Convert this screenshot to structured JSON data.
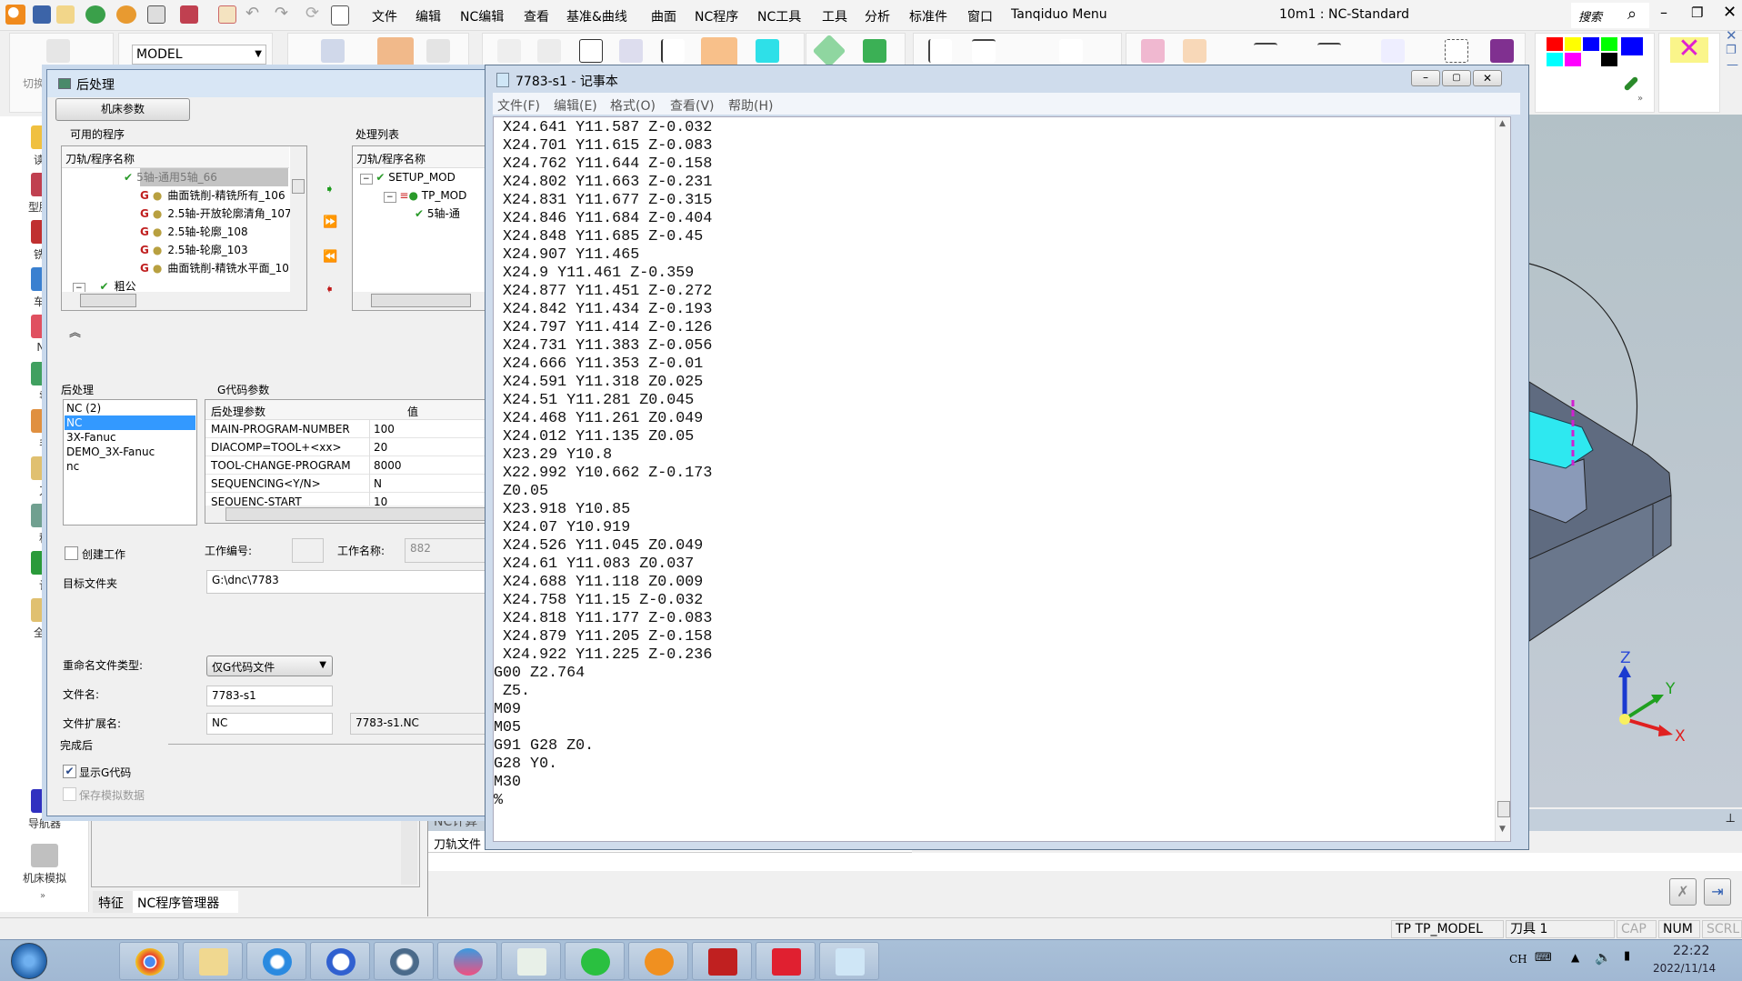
{
  "app": {
    "title": "10m1 : NC-Standard",
    "menu": [
      "文件",
      "编辑",
      "NC编辑",
      "查看",
      "基准&曲线",
      "曲面",
      "NC程序",
      "NC工具",
      "工具",
      "分析",
      "标准件",
      "窗口",
      "Tanqiduo Menu"
    ],
    "search_label": "搜索",
    "toolbar": {
      "model_combo": "MODEL",
      "switch_label": "切换"
    },
    "palette": [
      "#ff0000",
      "#ffff00",
      "#0000ff",
      "#00ff00",
      "#00ffff",
      "#ff00ff",
      "#ffffff",
      "#000000"
    ]
  },
  "sidebar": {
    "items": [
      "读取",
      "型腔管",
      "铣削",
      "车削",
      "NC",
      "零",
      "毛",
      "刀",
      "程",
      "计",
      "全局",
      "导航器",
      "机床模拟"
    ]
  },
  "dialog": {
    "title": "后处理",
    "machine_params_button": "机床参数",
    "available_label": "可用的程序",
    "available_header": "刀轨/程序名称",
    "available_rows": [
      "5轴-通用5轴_66",
      "曲面铣削-精铣所有_106",
      "2.5轴-开放轮廓清角_107",
      "2.5轴-轮廓_108",
      "2.5轴-轮廓_103",
      "曲面铣削-精铣水平面_10",
      "粗公"
    ],
    "process_label": "处理列表",
    "process_header": "刀轨/程序名称",
    "process_rows": [
      "SETUP_MOD",
      "TP_MOD",
      "5轴-通"
    ],
    "post_label": "后处理",
    "post_list": [
      "NC (2)",
      "NC",
      "3X-Fanuc",
      "DEMO_3X-Fanuc",
      "nc"
    ],
    "post_selected": "NC",
    "gcode_label": "G代码参数",
    "gcode_headers": [
      "后处理参数",
      "值"
    ],
    "gcode_rows": [
      [
        "MAIN-PROGRAM-NUMBER",
        "100"
      ],
      [
        "DIACOMP=TOOL+<xx>",
        "20"
      ],
      [
        "TOOL-CHANGE-PROGRAM",
        "8000"
      ],
      [
        "SEQUENCING<Y/N>",
        "N"
      ],
      [
        "SEQUENC-START",
        "10"
      ]
    ],
    "create_job_label": "创建工作",
    "create_job_checked": false,
    "job_number_label": "工作编号:",
    "job_number_value": "",
    "job_name_label": "工作名称:",
    "job_name_value": "882",
    "target_folder_label": "目标文件夹",
    "target_folder_value": "G:\\dnc\\7783",
    "rename_type_label": "重命名文件类型:",
    "rename_type_value": "仅G代码文件",
    "file_name_label": "文件名:",
    "file_name_value": "7783-s1",
    "file_ext_label": "文件扩展名:",
    "file_ext_value": "NC",
    "file_full_name": "7783-s1.NC",
    "after_label": "完成后",
    "show_gcode_label": "显示G代码",
    "show_gcode_checked": true,
    "save_sim_label": "保存模拟数据",
    "save_sim_checked": false
  },
  "notepad": {
    "title": "7783-s1 - 记事本",
    "menu": [
      "文件(F)",
      "编辑(E)",
      "格式(O)",
      "查看(V)",
      "帮助(H)"
    ],
    "lines": [
      " X24.641 Y11.587 Z-0.032",
      " X24.701 Y11.615 Z-0.083",
      " X24.762 Y11.644 Z-0.158",
      " X24.802 Y11.663 Z-0.231",
      " X24.831 Y11.677 Z-0.315",
      " X24.846 Y11.684 Z-0.404",
      " X24.848 Y11.685 Z-0.45",
      " X24.907 Y11.465",
      " X24.9 Y11.461 Z-0.359",
      " X24.877 Y11.451 Z-0.272",
      " X24.842 Y11.434 Z-0.193",
      " X24.797 Y11.414 Z-0.126",
      " X24.731 Y11.383 Z-0.056",
      " X24.666 Y11.353 Z-0.01",
      " X24.591 Y11.318 Z0.025",
      " X24.51 Y11.281 Z0.045",
      " X24.468 Y11.261 Z0.049",
      " X24.012 Y11.135 Z0.05",
      " X23.29 Y10.8",
      " X22.992 Y10.662 Z-0.173",
      " Z0.05",
      " X23.918 Y10.85",
      " X24.07 Y10.919",
      " X24.526 Y11.045 Z0.049",
      " X24.61 Y11.083 Z0.037",
      " X24.688 Y11.118 Z0.009",
      " X24.758 Y11.15 Z-0.032",
      " X24.818 Y11.177 Z-0.083",
      " X24.879 Y11.205 Z-0.158",
      " X24.922 Y11.225 Z-0.236",
      "G00 Z2.764",
      " Z5.",
      "M09",
      "M05",
      "G91 G28 Z0.",
      "G28 Y0.",
      "M30",
      "%"
    ]
  },
  "viewport": {
    "axes": [
      "X",
      "Y",
      "Z"
    ]
  },
  "bottom": {
    "tabs": [
      "特征",
      "NC程序管理器"
    ],
    "nc_panel_title": "NC计算",
    "nc_panel_col": "刀轨文件"
  },
  "statusbar": [
    "TP  TP_MODEL",
    "刀具 1",
    "CAP",
    "NUM",
    "SCRL"
  ],
  "taskbar": {
    "apps": [
      "chrome",
      "file-explorer",
      "internet-explorer",
      "iu",
      "app-5",
      "abc",
      "window-app",
      "wechat",
      "cimatron",
      "solidworks",
      "xmind",
      "notepad"
    ],
    "lang": "CH",
    "time": "22:22",
    "date": "2022/11/14"
  }
}
